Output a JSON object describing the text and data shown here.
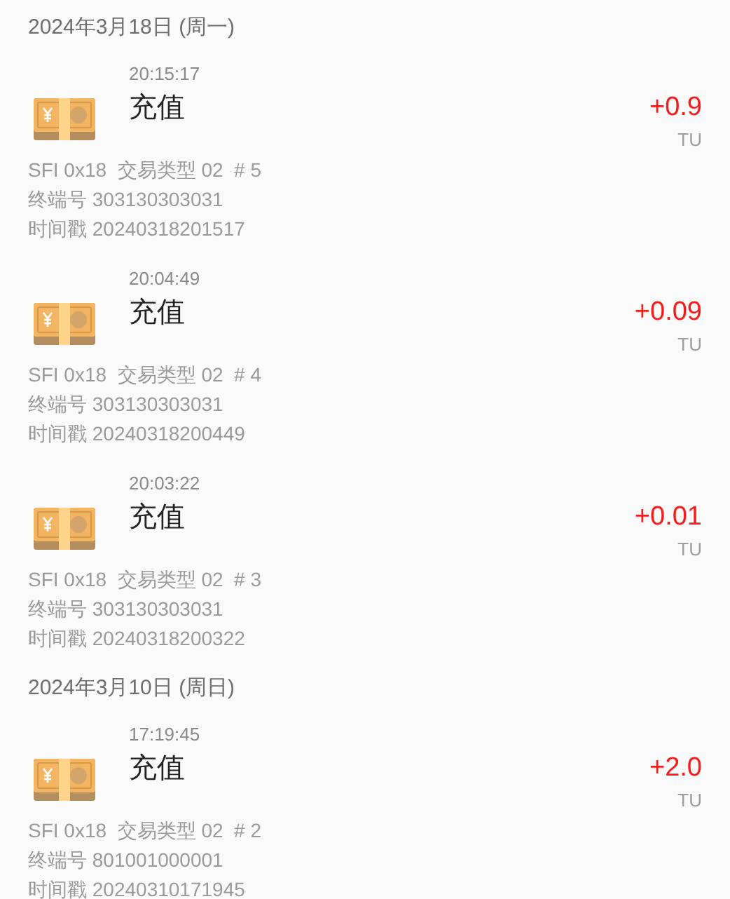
{
  "groups": [
    {
      "date": "2024年3月18日 (周一)",
      "items": [
        {
          "time": "20:15:17",
          "title": "充值",
          "amount": "+0.9",
          "unit": "TU",
          "details": [
            "SFI 0x18  交易类型 02  # 5",
            "终端号 303130303031",
            "时间戳 20240318201517"
          ]
        },
        {
          "time": "20:04:49",
          "title": "充值",
          "amount": "+0.09",
          "unit": "TU",
          "details": [
            "SFI 0x18  交易类型 02  # 4",
            "终端号 303130303031",
            "时间戳 20240318200449"
          ]
        },
        {
          "time": "20:03:22",
          "title": "充值",
          "amount": "+0.01",
          "unit": "TU",
          "details": [
            "SFI 0x18  交易类型 02  # 3",
            "终端号 303130303031",
            "时间戳 20240318200322"
          ]
        }
      ]
    },
    {
      "date": "2024年3月10日 (周日)",
      "items": [
        {
          "time": "17:19:45",
          "title": "充值",
          "amount": "+2.0",
          "unit": "TU",
          "details": [
            "SFI 0x18  交易类型 02  # 2",
            "终端号 801001000001",
            "时间戳 20240310171945"
          ]
        }
      ]
    }
  ]
}
